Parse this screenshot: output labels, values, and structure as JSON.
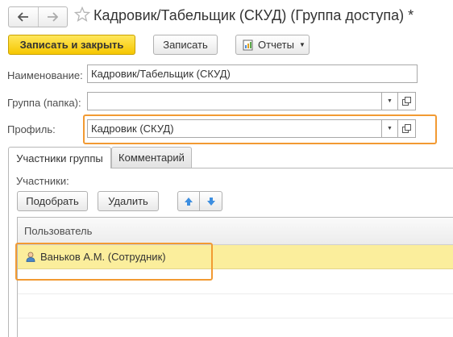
{
  "window": {
    "title": "Кадровик/Табельщик (СКУД) (Группа доступа) *",
    "back_icon": "arrow-left-icon",
    "forward_icon": "arrow-right-icon",
    "favorite_icon": "star-icon"
  },
  "toolbar": {
    "save_close_label": "Записать и закрыть",
    "save_label": "Записать",
    "reports_label": "Отчеты",
    "reports_icon": "report-icon"
  },
  "form": {
    "name_label": "Наименование:",
    "name_value": "Кадровик/Табельщик (СКУД)",
    "group_label": "Группа (папка):",
    "group_value": "",
    "profile_label": "Профиль:",
    "profile_value": "Кадровик (СКУД)"
  },
  "tabs": [
    {
      "label": "Участники группы",
      "active": true
    },
    {
      "label": "Комментарий",
      "active": false
    }
  ],
  "participants": {
    "label": "Участники:",
    "pick_label": "Подобрать",
    "delete_label": "Удалить",
    "move_up_icon": "arrow-up-icon",
    "move_down_icon": "arrow-down-icon",
    "table": {
      "columns": [
        "Пользователь"
      ],
      "rows": [
        {
          "user": "Ваньков А.М. (Сотрудник)",
          "icon": "user-icon",
          "selected": true
        }
      ]
    }
  },
  "colors": {
    "primary_button": "#f6c700",
    "highlight_border": "#f29a32",
    "selected_row": "#fbee9c",
    "arrow_blue": "#3d8ee0"
  }
}
